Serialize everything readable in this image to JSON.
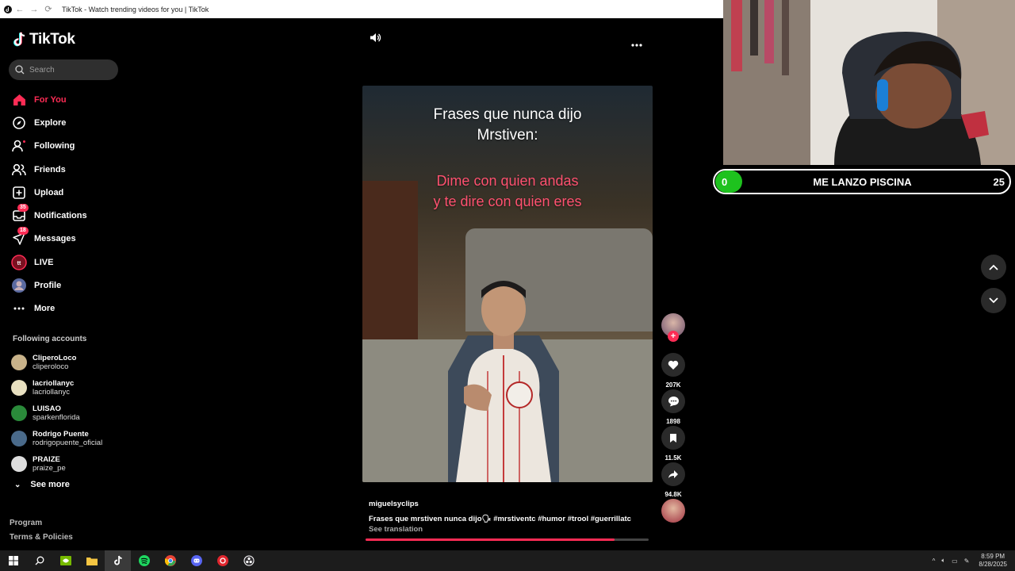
{
  "window": {
    "title": "TikTok - Watch trending videos for you | TikTok"
  },
  "app": {
    "name": "TikTok"
  },
  "search": {
    "placeholder": "Search"
  },
  "nav": [
    {
      "label": "For You",
      "icon": "home-icon",
      "active": true
    },
    {
      "label": "Explore",
      "icon": "compass-icon"
    },
    {
      "label": "Following",
      "icon": "following-icon"
    },
    {
      "label": "Friends",
      "icon": "friends-icon"
    },
    {
      "label": "Upload",
      "icon": "upload-icon"
    },
    {
      "label": "Notifications",
      "icon": "inbox-icon",
      "badge": "35"
    },
    {
      "label": "Messages",
      "icon": "send-icon",
      "badge": "18"
    },
    {
      "label": "LIVE",
      "icon": "live-icon"
    },
    {
      "label": "Profile",
      "icon": "profile-icon"
    },
    {
      "label": "More",
      "icon": "more-icon"
    }
  ],
  "following_accounts": {
    "title": "Following accounts",
    "items": [
      {
        "name": "CliperoLoco",
        "handle": "cliperoloco",
        "color": "#c9b38a"
      },
      {
        "name": "lacriollanyc",
        "handle": "lacriollanyc",
        "color": "#e8e0c0"
      },
      {
        "name": "LUISAO",
        "handle": "sparkenflorida",
        "color": "#2a8a3a"
      },
      {
        "name": "Rodrigo Puente",
        "handle": "rodrigopuente_oficial",
        "color": "#4a6a8a"
      },
      {
        "name": "PRAIZE",
        "handle": "praize_pe",
        "color": "#dddddd"
      }
    ],
    "see_more": "See more"
  },
  "footer": {
    "links": [
      "Program",
      "Terms & Policies"
    ]
  },
  "video": {
    "caption_white": [
      "Frases que nunca dijo",
      "Mrstiven:"
    ],
    "caption_red": [
      "Dime con quien andas",
      "y te dire con quien eres"
    ],
    "author": "miguelsyclips",
    "description": "Frases que mrstiven nunca dijo🗣 #mrstiventc  #humor  #trool  #guerrillatc",
    "see_translation": "See translation",
    "progress": 0.88
  },
  "actions": {
    "likes": "207K",
    "comments": "1898",
    "saves": "11.5K",
    "shares": "94.8K"
  },
  "overlay": {
    "left": "0",
    "label": "ME LANZO PISCINA",
    "right": "25"
  },
  "taskbar": {
    "time": "8:59 PM",
    "date": "8/28/2025"
  },
  "colors": {
    "accent": "#fe2c55",
    "overlay_green": "#1ec21e"
  }
}
